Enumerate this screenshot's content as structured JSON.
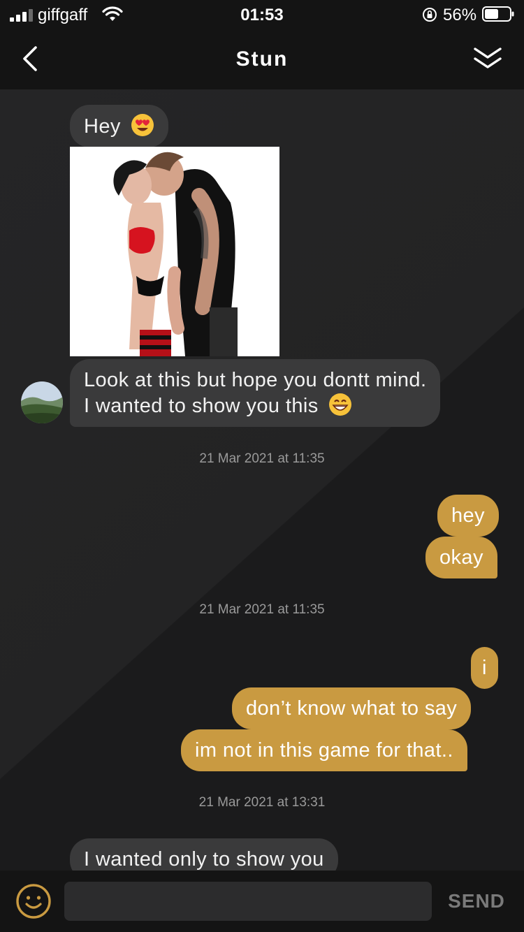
{
  "status_bar": {
    "carrier": "giffgaff",
    "time": "01:53",
    "battery_percent": "56%",
    "battery_level": 0.56,
    "icons": [
      "signal-icon",
      "wifi-icon",
      "orientation-lock-icon",
      "battery-icon"
    ]
  },
  "header": {
    "title": "Stun",
    "back_icon": "chevron-left-icon",
    "collapse_icon": "double-chevron-down-icon"
  },
  "messages": {
    "m1": "Hey",
    "m1_emoji": "heart-eyes-emoji",
    "m3_line1": "Look at this but hope you dontt mind.",
    "m3_line2": "I wanted to show you this",
    "m3_emoji": "grinning-face-emoji",
    "ts1": "21 Mar 2021 at 11:35",
    "o1": "hey",
    "o2": "okay",
    "ts2": "21 Mar 2021 at 11:35",
    "o3": "i",
    "o4": "don’t know what to say",
    "o5": "im not in this game for that..",
    "ts3": "21 Mar 2021 at 13:31",
    "m4": "I wanted only to show you"
  },
  "composer": {
    "value": "",
    "send_label": "SEND",
    "emoji_icon": "smiley-icon"
  },
  "colors": {
    "outgoing_bubble": "#c99a41",
    "incoming_bubble": "#3a3a3b",
    "background": "#1e1e1f",
    "bar": "#141414"
  }
}
